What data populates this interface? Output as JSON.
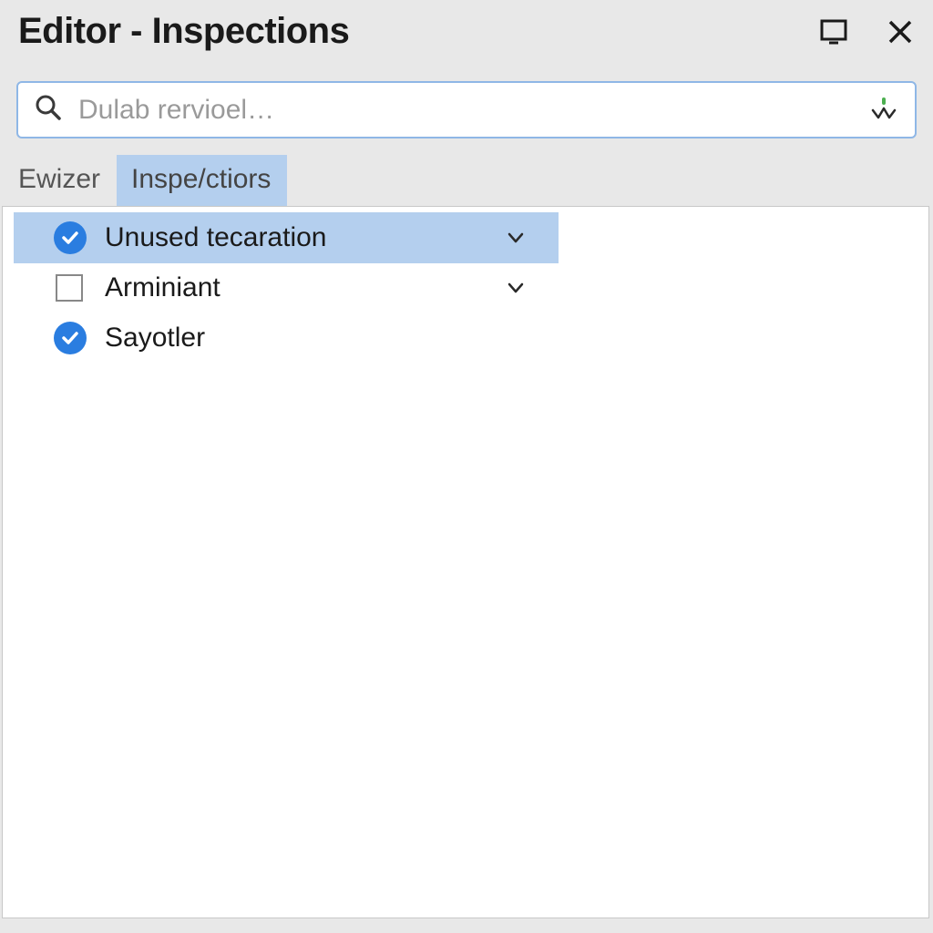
{
  "titlebar": {
    "title": "Editor - Inspections"
  },
  "search": {
    "placeholder": "Dulab rervioel…"
  },
  "tabs": [
    {
      "label": "Ewizer",
      "active": false
    },
    {
      "label": "Inspe/ctiors",
      "active": true
    }
  ],
  "list": [
    {
      "label": "Unused tecaration",
      "checked": true,
      "type": "circle",
      "expandable": true,
      "selected": true
    },
    {
      "label": "Arminiant",
      "checked": false,
      "type": "square",
      "expandable": true,
      "selected": false
    },
    {
      "label": "Sayotler",
      "checked": true,
      "type": "circle",
      "expandable": false,
      "selected": false
    }
  ]
}
